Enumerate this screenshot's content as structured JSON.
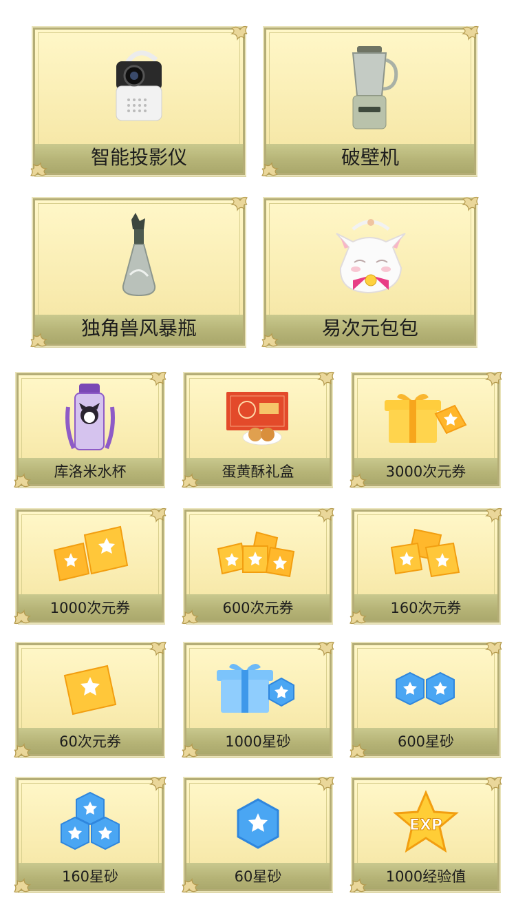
{
  "prizes": {
    "grand": [
      {
        "label": "智能投影仪",
        "icon": "projector-icon"
      },
      {
        "label": "破壁机",
        "icon": "blender-icon"
      },
      {
        "label": "独角兽风暴瓶",
        "icon": "unicorn-storm-bottle-icon"
      },
      {
        "label": "易次元包包",
        "icon": "cat-plush-bag-icon"
      }
    ],
    "regular": [
      {
        "label": "库洛米水杯",
        "icon": "kuromi-water-bottle-icon"
      },
      {
        "label": "蛋黄酥礼盒",
        "icon": "pastry-gift-box-icon"
      },
      {
        "label": "3000次元券",
        "icon": "gift-box-coupon-icon"
      },
      {
        "label": "1000次元券",
        "icon": "coupon-stack-icon"
      },
      {
        "label": "600次元券",
        "icon": "coupon-pile-icon"
      },
      {
        "label": "160次元券",
        "icon": "coupon-pair-icon"
      },
      {
        "label": "60次元券",
        "icon": "coupon-single-icon"
      },
      {
        "label": "1000星砂",
        "icon": "gift-box-stardust-icon"
      },
      {
        "label": "600星砂",
        "icon": "stardust-pair-icon"
      },
      {
        "label": "160星砂",
        "icon": "stardust-cluster-icon"
      },
      {
        "label": "60星砂",
        "icon": "stardust-single-icon"
      },
      {
        "label": "1000经验值",
        "icon": "exp-star-icon",
        "badge": "EXP"
      }
    ]
  },
  "colors": {
    "card_bg": "#fbf0b6",
    "card_border": "#b4ad76",
    "label_strip": "#b6b477",
    "coupon_yellow": "#ffc93a",
    "stardust_blue": "#4aa6f3"
  }
}
